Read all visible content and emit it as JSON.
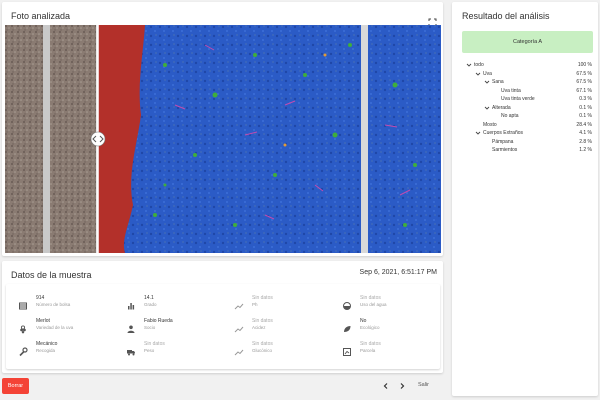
{
  "photo": {
    "title": "Foto analizada"
  },
  "sample": {
    "title": "Datos de la muestra",
    "date": "Sep 6, 2021, 6:51:17 PM",
    "fields": [
      {
        "icon": "table-icon",
        "value": "914",
        "label": "Número de bolsa",
        "has_data": true
      },
      {
        "icon": "bar-chart-icon",
        "value": "14.1",
        "label": "Grado",
        "has_data": true
      },
      {
        "icon": "trend-icon",
        "value": "Sin datos",
        "label": "Ph",
        "has_data": false
      },
      {
        "icon": "gauge-icon",
        "value": "Sin datos",
        "label": "Uso del agua",
        "has_data": false
      },
      {
        "icon": "grape-icon",
        "value": "Merlot",
        "label": "Variedad de la uva",
        "has_data": true
      },
      {
        "icon": "person-icon",
        "value": "Fabio Rueda",
        "label": "Socio",
        "has_data": true
      },
      {
        "icon": "trend-icon",
        "value": "Sin datos",
        "label": "Acidez",
        "has_data": false
      },
      {
        "icon": "leaf-icon",
        "value": "No",
        "label": "Ecológico",
        "has_data": true
      },
      {
        "icon": "wrench-icon",
        "value": "Mecánico",
        "label": "Recogida",
        "has_data": true
      },
      {
        "icon": "truck-icon",
        "value": "Sin datos",
        "label": "Peso",
        "has_data": false
      },
      {
        "icon": "trend-icon",
        "value": "Sin datos",
        "label": "Glucónico",
        "has_data": false
      },
      {
        "icon": "map-icon",
        "value": "Sin datos",
        "label": "Parcela",
        "has_data": false
      }
    ]
  },
  "actions": {
    "delete_label": "Borrar",
    "exit_label": "Salir"
  },
  "result": {
    "title": "Resultado del análisis",
    "category": "Categoría A",
    "tree": [
      {
        "label": "todo",
        "value": "100 %",
        "level": 0,
        "expandable": true
      },
      {
        "label": "Uva",
        "value": "67.5 %",
        "level": 1,
        "expandable": true
      },
      {
        "label": "Sana",
        "value": "67.5 %",
        "level": 2,
        "expandable": true
      },
      {
        "label": "Uva tinta",
        "value": "67.1 %",
        "level": 3,
        "expandable": false
      },
      {
        "label": "Uva tinta verde",
        "value": "0.3 %",
        "level": 3,
        "expandable": false
      },
      {
        "label": "Alterada",
        "value": "0.1 %",
        "level": 2,
        "expandable": true
      },
      {
        "label": "No apta",
        "value": "0.1 %",
        "level": 3,
        "expandable": false
      },
      {
        "label": "Mosto",
        "value": "28.4 %",
        "level": 1,
        "expandable": false
      },
      {
        "label": "Cuerpos Extraños",
        "value": "4.1 %",
        "level": 1,
        "expandable": true
      },
      {
        "label": "Pámpana",
        "value": "2.8 %",
        "level": 2,
        "expandable": false
      },
      {
        "label": "Sarmientos",
        "value": "1.2 %",
        "level": 2,
        "expandable": false
      }
    ]
  },
  "colors": {
    "accent_green": "#c8efc2",
    "delete_red": "#f44336",
    "mask_blue": "#2a5cc4",
    "mask_red": "#b3302a"
  }
}
